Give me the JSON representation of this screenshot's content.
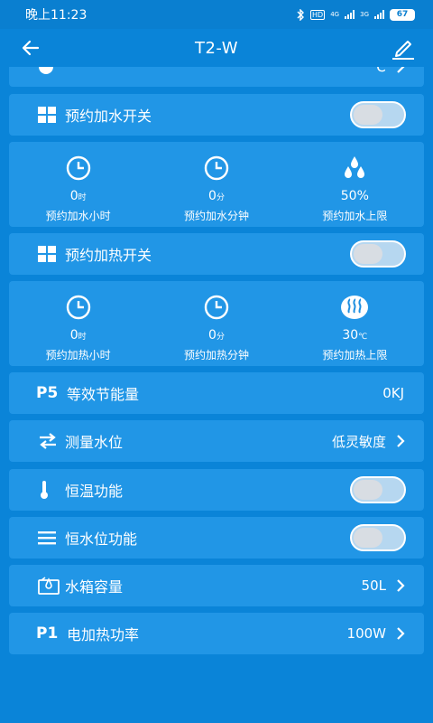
{
  "status": {
    "time": "晚上11:23",
    "battery": "67",
    "hd": "HD",
    "net1": "4G",
    "net2": "3G"
  },
  "appbar": {
    "title": "T2-W"
  },
  "partial_row": {
    "value": "℃"
  },
  "reserve_water_switch": {
    "label": "预约加水开关",
    "enabled": false
  },
  "reserve_water_stats": [
    {
      "value": "0",
      "unit": "时",
      "caption": "预约加水小时",
      "icon": "clock-icon"
    },
    {
      "value": "0",
      "unit": "分",
      "caption": "预约加水分钟",
      "icon": "clock-icon"
    },
    {
      "value": "50%",
      "unit": "",
      "caption": "预约加水上限",
      "icon": "water-drops-icon"
    }
  ],
  "reserve_heat_switch": {
    "label": "预约加热开关",
    "enabled": false
  },
  "reserve_heat_stats": [
    {
      "value": "0",
      "unit": "时",
      "caption": "预约加热小时",
      "icon": "clock-icon"
    },
    {
      "value": "0",
      "unit": "分",
      "caption": "预约加热分钟",
      "icon": "clock-icon"
    },
    {
      "value": "30",
      "unit": "℃",
      "caption": "预约加热上限",
      "icon": "heat-icon"
    }
  ],
  "energy_row": {
    "code": "P5",
    "label": "等效节能量",
    "value": "0KJ"
  },
  "water_level_row": {
    "label": "测量水位",
    "value": "低灵敏度"
  },
  "thermostat_row": {
    "label": "恒温功能",
    "enabled": false
  },
  "constant_level_row": {
    "label": "恒水位功能",
    "enabled": false
  },
  "tank_row": {
    "label": "水箱容量",
    "value": "50L"
  },
  "heater_row": {
    "code": "P1",
    "label": "电加热功率",
    "value": "100W"
  }
}
